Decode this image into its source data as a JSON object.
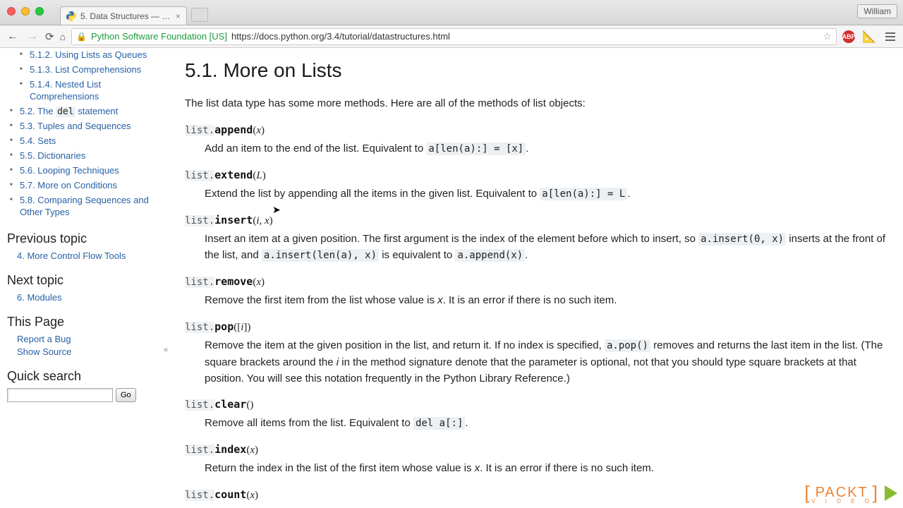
{
  "browser": {
    "user": "William",
    "tab_title": "5. Data Structures — Pyth…",
    "ev_label": "Python Software Foundation [US]",
    "url": "https://docs.python.org/3.4/tutorial/datastructures.html",
    "abp": "ABP"
  },
  "sidebar": {
    "toc": [
      {
        "label": "5.1.2. Using Lists as Queues"
      },
      {
        "label": "5.1.3. List Comprehensions"
      },
      {
        "label": "5.1.4. Nested List Comprehensions"
      }
    ],
    "toc2": [
      {
        "pre": "5.2. The ",
        "code": "del",
        "post": " statement"
      },
      {
        "pre": "5.3. Tuples and Sequences"
      },
      {
        "pre": "5.4. Sets"
      },
      {
        "pre": "5.5. Dictionaries"
      },
      {
        "pre": "5.6. Looping Techniques"
      },
      {
        "pre": "5.7. More on Conditions"
      },
      {
        "pre": "5.8. Comparing Sequences and Other Types"
      }
    ],
    "prev_heading": "Previous topic",
    "prev_link": "4. More Control Flow Tools",
    "next_heading": "Next topic",
    "next_link": "6. Modules",
    "thispage_heading": "This Page",
    "bug_link": "Report a Bug",
    "source_link": "Show Source",
    "quicksearch_heading": "Quick search",
    "go_label": "Go"
  },
  "main": {
    "heading": "5.1. More on Lists",
    "intro": "The list data type has some more methods. Here are all of the methods of list objects:",
    "methods": {
      "append": {
        "cls": "list.",
        "fn": "append",
        "sig_open": "(",
        "arg": "x",
        "sig_close": ")",
        "desc_a": "Add an item to the end of the list. Equivalent to ",
        "code": "a[len(a):] = [x]",
        "desc_b": "."
      },
      "extend": {
        "cls": "list.",
        "fn": "extend",
        "sig_open": "(",
        "arg": "L",
        "sig_close": ")",
        "desc_a": "Extend the list by appending all the items in the given list. Equivalent to ",
        "code": "a[len(a):] = L",
        "desc_b": "."
      },
      "insert": {
        "cls": "list.",
        "fn": "insert",
        "sig_open": "(",
        "arg": "i, x",
        "sig_close": ")",
        "desc_a": "Insert an item at a given position. The first argument is the index of the element before which to insert, so ",
        "code1": "a.insert(0, x)",
        "desc_b": " inserts at the front of the list, and ",
        "code2": "a.insert(len(a), x)",
        "desc_c": " is equivalent to ",
        "code3": "a.append(x)",
        "desc_d": "."
      },
      "remove": {
        "cls": "list.",
        "fn": "remove",
        "sig_open": "(",
        "arg": "x",
        "sig_close": ")",
        "desc_a": "Remove the first item from the list whose value is ",
        "em": "x",
        "desc_b": ". It is an error if there is no such item."
      },
      "pop": {
        "cls": "list.",
        "fn": "pop",
        "sig_open": "([",
        "arg": "i",
        "sig_close": "])",
        "desc_a": "Remove the item at the given position in the list, and return it. If no index is specified, ",
        "code": "a.pop()",
        "desc_b": " removes and returns the last item in the list. (The square brackets around the ",
        "em": "i",
        "desc_c": " in the method signature denote that the parameter is optional, not that you should type square brackets at that position. You will see this notation frequently in the Python Library Reference.)"
      },
      "clear": {
        "cls": "list.",
        "fn": "clear",
        "sig_open": "(",
        "arg": "",
        "sig_close": ")",
        "desc_a": "Remove all items from the list. Equivalent to ",
        "code": "del a[:]",
        "desc_b": "."
      },
      "index": {
        "cls": "list.",
        "fn": "index",
        "sig_open": "(",
        "arg": "x",
        "sig_close": ")",
        "desc_a": "Return the index in the list of the first item whose value is ",
        "em": "x",
        "desc_b": ". It is an error if there is no such item."
      },
      "count": {
        "cls": "list.",
        "fn": "count",
        "sig_open": "(",
        "arg": "x",
        "sig_close": ")"
      }
    }
  },
  "watermark": {
    "text": "PACKT",
    "sub": "V I D E O"
  }
}
